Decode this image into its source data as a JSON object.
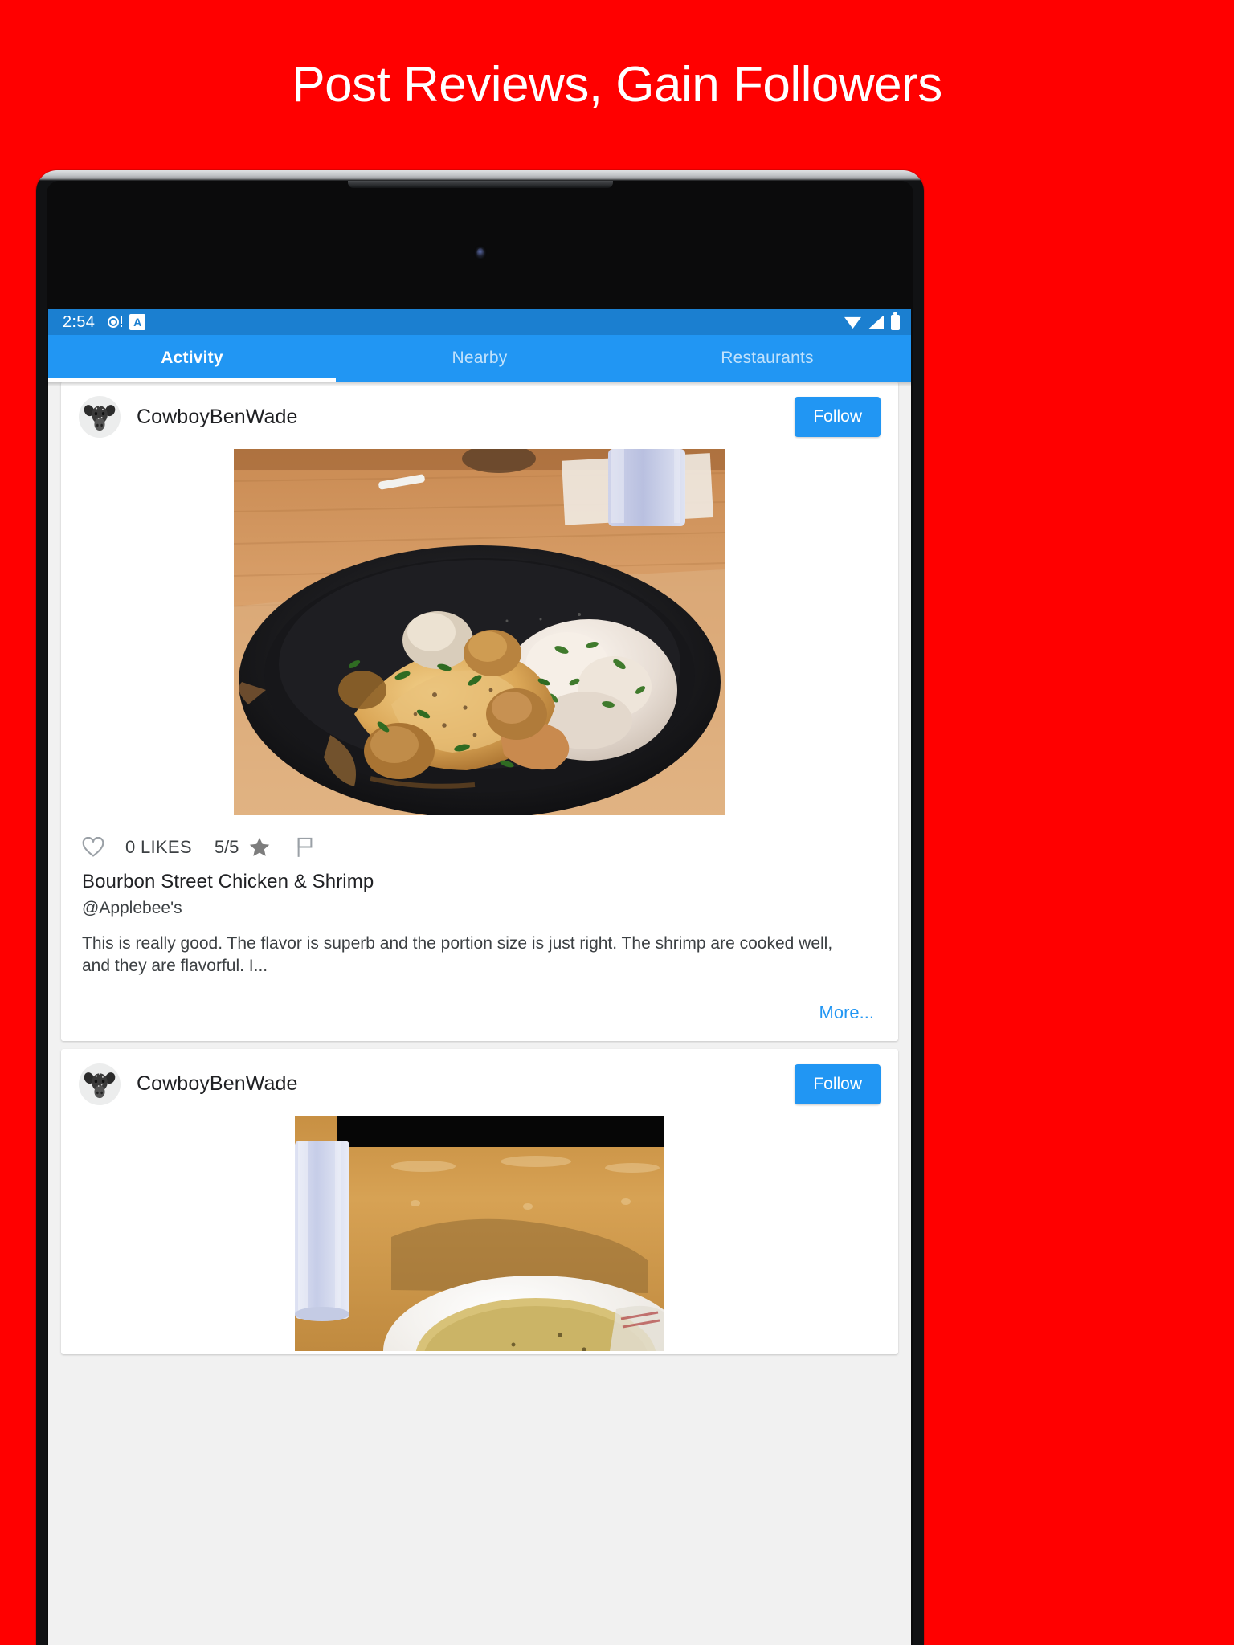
{
  "promo": {
    "headline": "Post Reviews, Gain Followers",
    "background_color": "#ff0000",
    "headline_color": "#ffffff"
  },
  "device": {
    "type": "android-tablet",
    "bezel_color": "#0b0b0c",
    "frame_color": "#c4c7ca"
  },
  "statusbar": {
    "time": "2:54",
    "background_color": "#1b7fd0",
    "left_icons": [
      "alarm-icon",
      "a-badge-icon"
    ],
    "right_icons": [
      "wifi-icon",
      "signal-icon",
      "battery-icon"
    ]
  },
  "tabs": {
    "accent_color": "#2196f3",
    "active_index": 0,
    "items": [
      {
        "label": "Activity"
      },
      {
        "label": "Nearby"
      },
      {
        "label": "Restaurants"
      }
    ]
  },
  "feed": {
    "posts": [
      {
        "username": "CowboyBenWade",
        "avatar": "cow-head-avatar",
        "follow_label": "Follow",
        "photo": "plated-bourbon-street-chicken-and-shrimp",
        "likes": "0 LIKES",
        "rating": "5/5",
        "title": "Bourbon Street Chicken & Shrimp",
        "place": "@Applebee's",
        "body": "This is really good. The flavor is superb and the portion size is just right. The shrimp are cooked well, and they are flavorful. I...",
        "more_label": "More..."
      },
      {
        "username": "CowboyBenWade",
        "avatar": "cow-head-avatar",
        "follow_label": "Follow",
        "photo": "table-with-drink-glass-and-soup-bowl"
      }
    ]
  }
}
